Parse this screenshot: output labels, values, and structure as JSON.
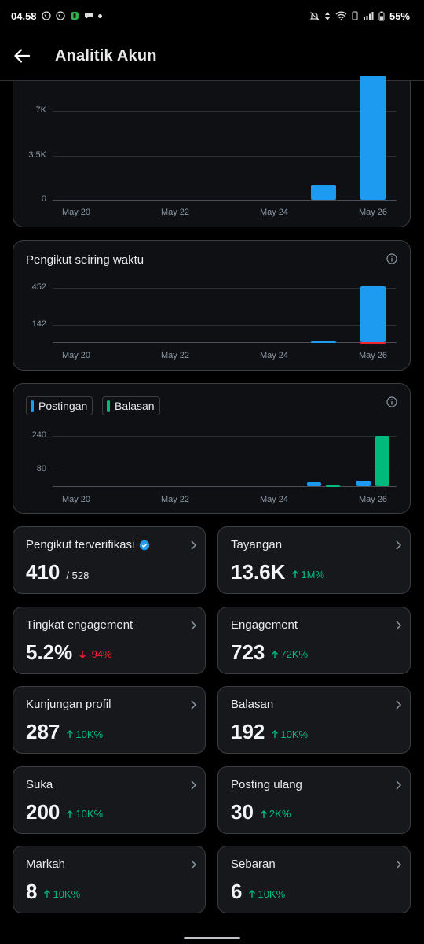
{
  "status_bar": {
    "time": "04.58",
    "battery": "55%"
  },
  "header": {
    "title": "Analitik Akun"
  },
  "colors": {
    "blue": "#1d9bf0",
    "green": "#00ba7c",
    "red": "#f4212e"
  },
  "chart_data": [
    {
      "type": "bar",
      "title": "",
      "categories": [
        "May 20",
        "May 21",
        "May 22",
        "May 23",
        "May 24",
        "May 25",
        "May 26"
      ],
      "x_tick_labels": [
        "May 20",
        "May 22",
        "May 24",
        "May 26"
      ],
      "y_tick_labels": [
        "0",
        "3.5K",
        "7K"
      ],
      "ylim": [
        0,
        10000
      ],
      "series": [
        {
          "values": [
            0,
            0,
            0,
            0,
            0,
            1200,
            9800
          ]
        }
      ],
      "grid": true
    },
    {
      "type": "bar",
      "title": "Pengikut seiring waktu",
      "categories": [
        "May 20",
        "May 21",
        "May 22",
        "May 23",
        "May 24",
        "May 25",
        "May 26"
      ],
      "x_tick_labels": [
        "May 20",
        "May 22",
        "May 24",
        "May 26"
      ],
      "y_tick_labels": [
        "142",
        "452"
      ],
      "ylim": [
        0,
        520
      ],
      "series": [
        {
          "values": [
            0,
            0,
            0,
            0,
            0,
            5,
            470
          ]
        },
        {
          "values": [
            0,
            0,
            0,
            0,
            0,
            0,
            -12
          ]
        }
      ],
      "grid": true
    },
    {
      "type": "bar",
      "title": "",
      "categories": [
        "May 20",
        "May 21",
        "May 22",
        "May 23",
        "May 24",
        "May 25",
        "May 26"
      ],
      "x_tick_labels": [
        "May 20",
        "May 22",
        "May 24",
        "May 26"
      ],
      "y_tick_labels": [
        "80",
        "240"
      ],
      "ylim": [
        0,
        260
      ],
      "legend": "top-left",
      "series": [
        {
          "name": "Postingan",
          "values": [
            0,
            0,
            0,
            0,
            0,
            18,
            28
          ]
        },
        {
          "name": "Balasan",
          "values": [
            0,
            0,
            0,
            0,
            0,
            3,
            240
          ]
        }
      ],
      "grid": true
    }
  ],
  "stats": [
    {
      "label": "Pengikut terverifikasi",
      "value": "410",
      "sub": "/ 528",
      "verified_badge": true,
      "delta": ""
    },
    {
      "label": "Tayangan",
      "value": "13.6K",
      "delta": "1M%",
      "direction": "up"
    },
    {
      "label": "Tingkat engagement",
      "value": "5.2%",
      "delta": "-94%",
      "direction": "down"
    },
    {
      "label": "Engagement",
      "value": "723",
      "delta": "72K%",
      "direction": "up"
    },
    {
      "label": "Kunjungan profil",
      "value": "287",
      "delta": "10K%",
      "direction": "up"
    },
    {
      "label": "Balasan",
      "value": "192",
      "delta": "10K%",
      "direction": "up"
    },
    {
      "label": "Suka",
      "value": "200",
      "delta": "10K%",
      "direction": "up"
    },
    {
      "label": "Posting ulang",
      "value": "30",
      "delta": "2K%",
      "direction": "up"
    },
    {
      "label": "Markah",
      "value": "8",
      "delta": "10K%",
      "direction": "up"
    },
    {
      "label": "Sebaran",
      "value": "6",
      "delta": "10K%",
      "direction": "up"
    }
  ]
}
